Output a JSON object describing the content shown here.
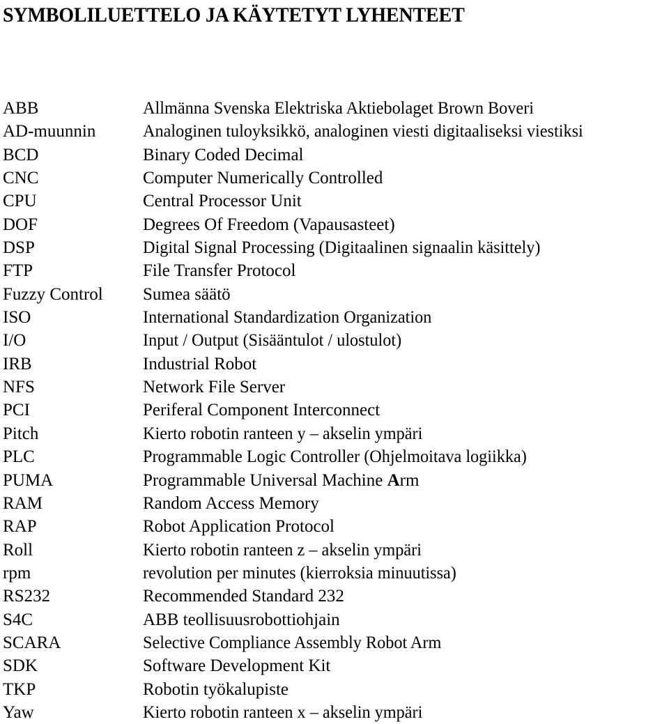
{
  "document": {
    "title": "SYMBOLILUETTELO JA KÄYTETYT LYHENTEET",
    "background_color": "#ffffff",
    "text_color": "#000000",
    "rows": [
      {
        "term": "ABB",
        "definition": "Allmänna Svenska Elektriska Aktiebolaget Brown Boveri"
      },
      {
        "term": "AD-muunnin",
        "definition": "Analoginen tuloyksikkö, analoginen viesti digitaaliseksi viestiksi"
      },
      {
        "term": "BCD",
        "definition": "Binary Coded Decimal"
      },
      {
        "term": "CNC",
        "definition": "Computer Numerically Controlled"
      },
      {
        "term": "CPU",
        "definition": "Central Processor Unit"
      },
      {
        "term": "DOF",
        "definition": "Degrees Of Freedom (Vapausasteet)"
      },
      {
        "term": "DSP",
        "definition": "Digital Signal Processing (Digitaalinen signaalin käsittely)"
      },
      {
        "term": "FTP",
        "definition": "File Transfer Protocol"
      },
      {
        "term": "Fuzzy Control",
        "definition": "Sumea säätö"
      },
      {
        "term": "ISO",
        "definition": "International Standardization Organization"
      },
      {
        "term": "I/O",
        "definition": "Input / Output (Sisääntulot / ulostulot)"
      },
      {
        "term": "IRB",
        "definition": "Industrial Robot"
      },
      {
        "term": "NFS",
        "definition": "Network File Server"
      },
      {
        "term": "PCI",
        "definition": "Periferal Component Interconnect"
      },
      {
        "term": "Pitch",
        "definition": "Kierto robotin ranteen y – akselin ympäri"
      },
      {
        "term": "PLC",
        "definition": "Programmable Logic Controller  (Ohjelmoitava logiikka)"
      },
      {
        "term": "PUMA",
        "definition": "Programmable Universal Machine Arm",
        "definition_prefix": "Programmable Universal Machine ",
        "definition_bold": "A",
        "definition_suffix": "rm"
      },
      {
        "term": "RAM",
        "definition": "Random Access Memory"
      },
      {
        "term": "RAP",
        "definition": "Robot Application Protocol"
      },
      {
        "term": "Roll",
        "definition": "Kierto robotin ranteen z – akselin ympäri"
      },
      {
        "term": "rpm",
        "definition": "revolution per minutes (kierroksia minuutissa)"
      },
      {
        "term": "RS232",
        "definition": "Recommended Standard 232"
      },
      {
        "term": "S4C",
        "definition": "ABB teollisuusrobottiohjain"
      },
      {
        "term": "SCARA",
        "definition": "Selective Compliance Assembly Robot Arm"
      },
      {
        "term": "SDK",
        "definition": "Software Development Kit"
      },
      {
        "term": "TKP",
        "definition": "Robotin työkalupiste"
      },
      {
        "term": "Yaw",
        "definition": "Kierto robotin ranteen x – akselin ympäri"
      }
    ]
  }
}
